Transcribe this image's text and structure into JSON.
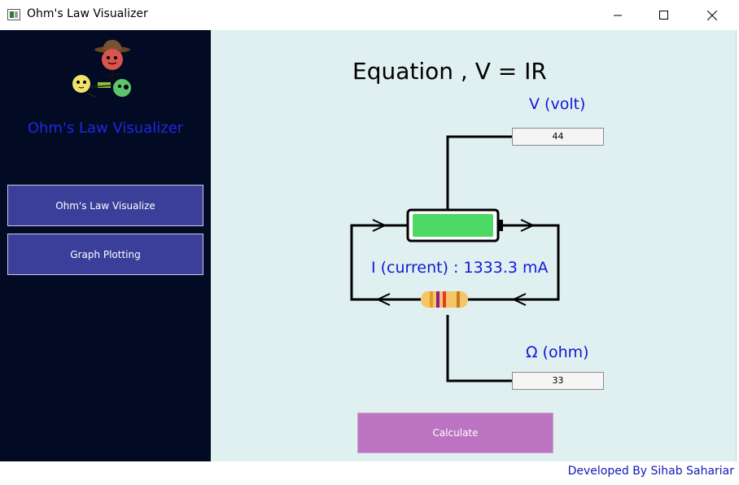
{
  "window": {
    "title": "Ohm's Law Visualizer"
  },
  "sidebar": {
    "title": "Ohm's Law Visualizer",
    "logo_icon": "cartoon-characters-logo",
    "nav": [
      {
        "label": "Ohm's Law Visualize"
      },
      {
        "label": "Graph Plotting"
      }
    ]
  },
  "main": {
    "equation": "Equation , V = IR",
    "voltage_label": "V (volt)",
    "voltage_value": "44",
    "current_label": "I (current) : 1333.3 mA",
    "resistance_label": "Ω (ohm)",
    "resistance_value": "33",
    "calculate_label": "Calculate"
  },
  "footer": {
    "credit": "Developed By Sihab Sahariar"
  },
  "colors": {
    "sidebar_bg": "#030a24",
    "nav_button_bg": "#3b3f99",
    "main_bg": "#e0f0f0",
    "label_blue": "#1218d6",
    "battery_green": "#4cd964",
    "calculate_bg": "#bb73c2"
  }
}
